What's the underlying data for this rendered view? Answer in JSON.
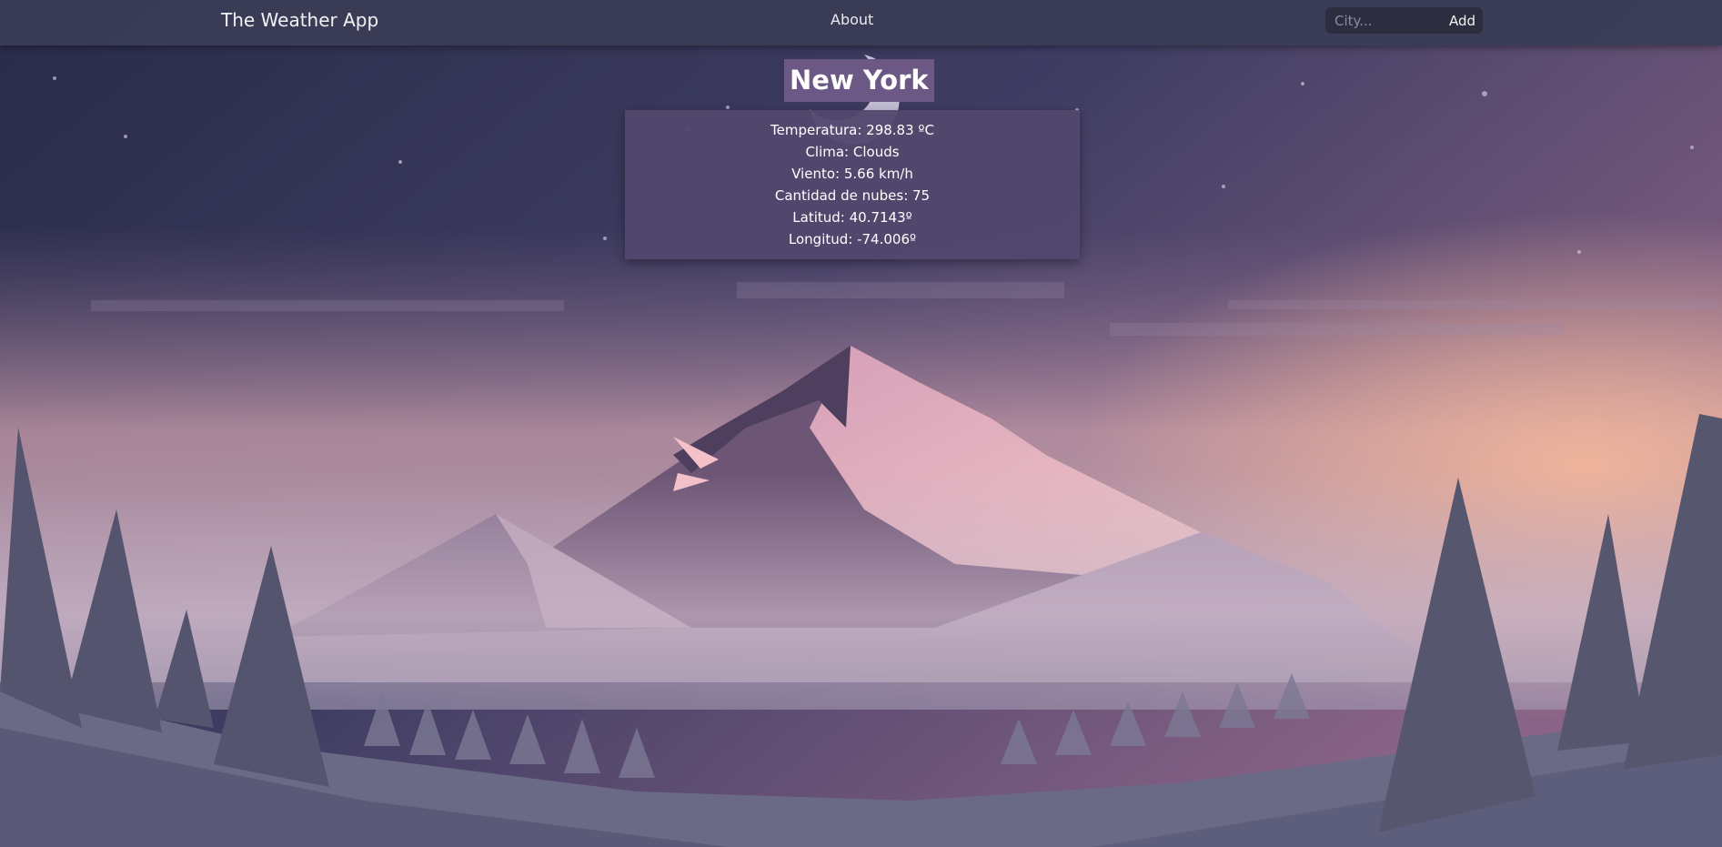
{
  "app": {
    "brand": "The Weather App",
    "nav_about": "About",
    "search_placeholder": "City...",
    "search_value": "",
    "add_label": "Add"
  },
  "weather": {
    "city": "New York",
    "rows": [
      "Temperatura: 298.83 ºC",
      "Clima: Clouds",
      "Viento: 5.66 km/h",
      "Cantidad de nubes: 75",
      "Latitud: 40.7143º",
      "Longitud: -74.006º"
    ]
  },
  "colors": {
    "navbar": "#3a3c56",
    "card": "#52486e",
    "title_bg": "#6b5885"
  }
}
